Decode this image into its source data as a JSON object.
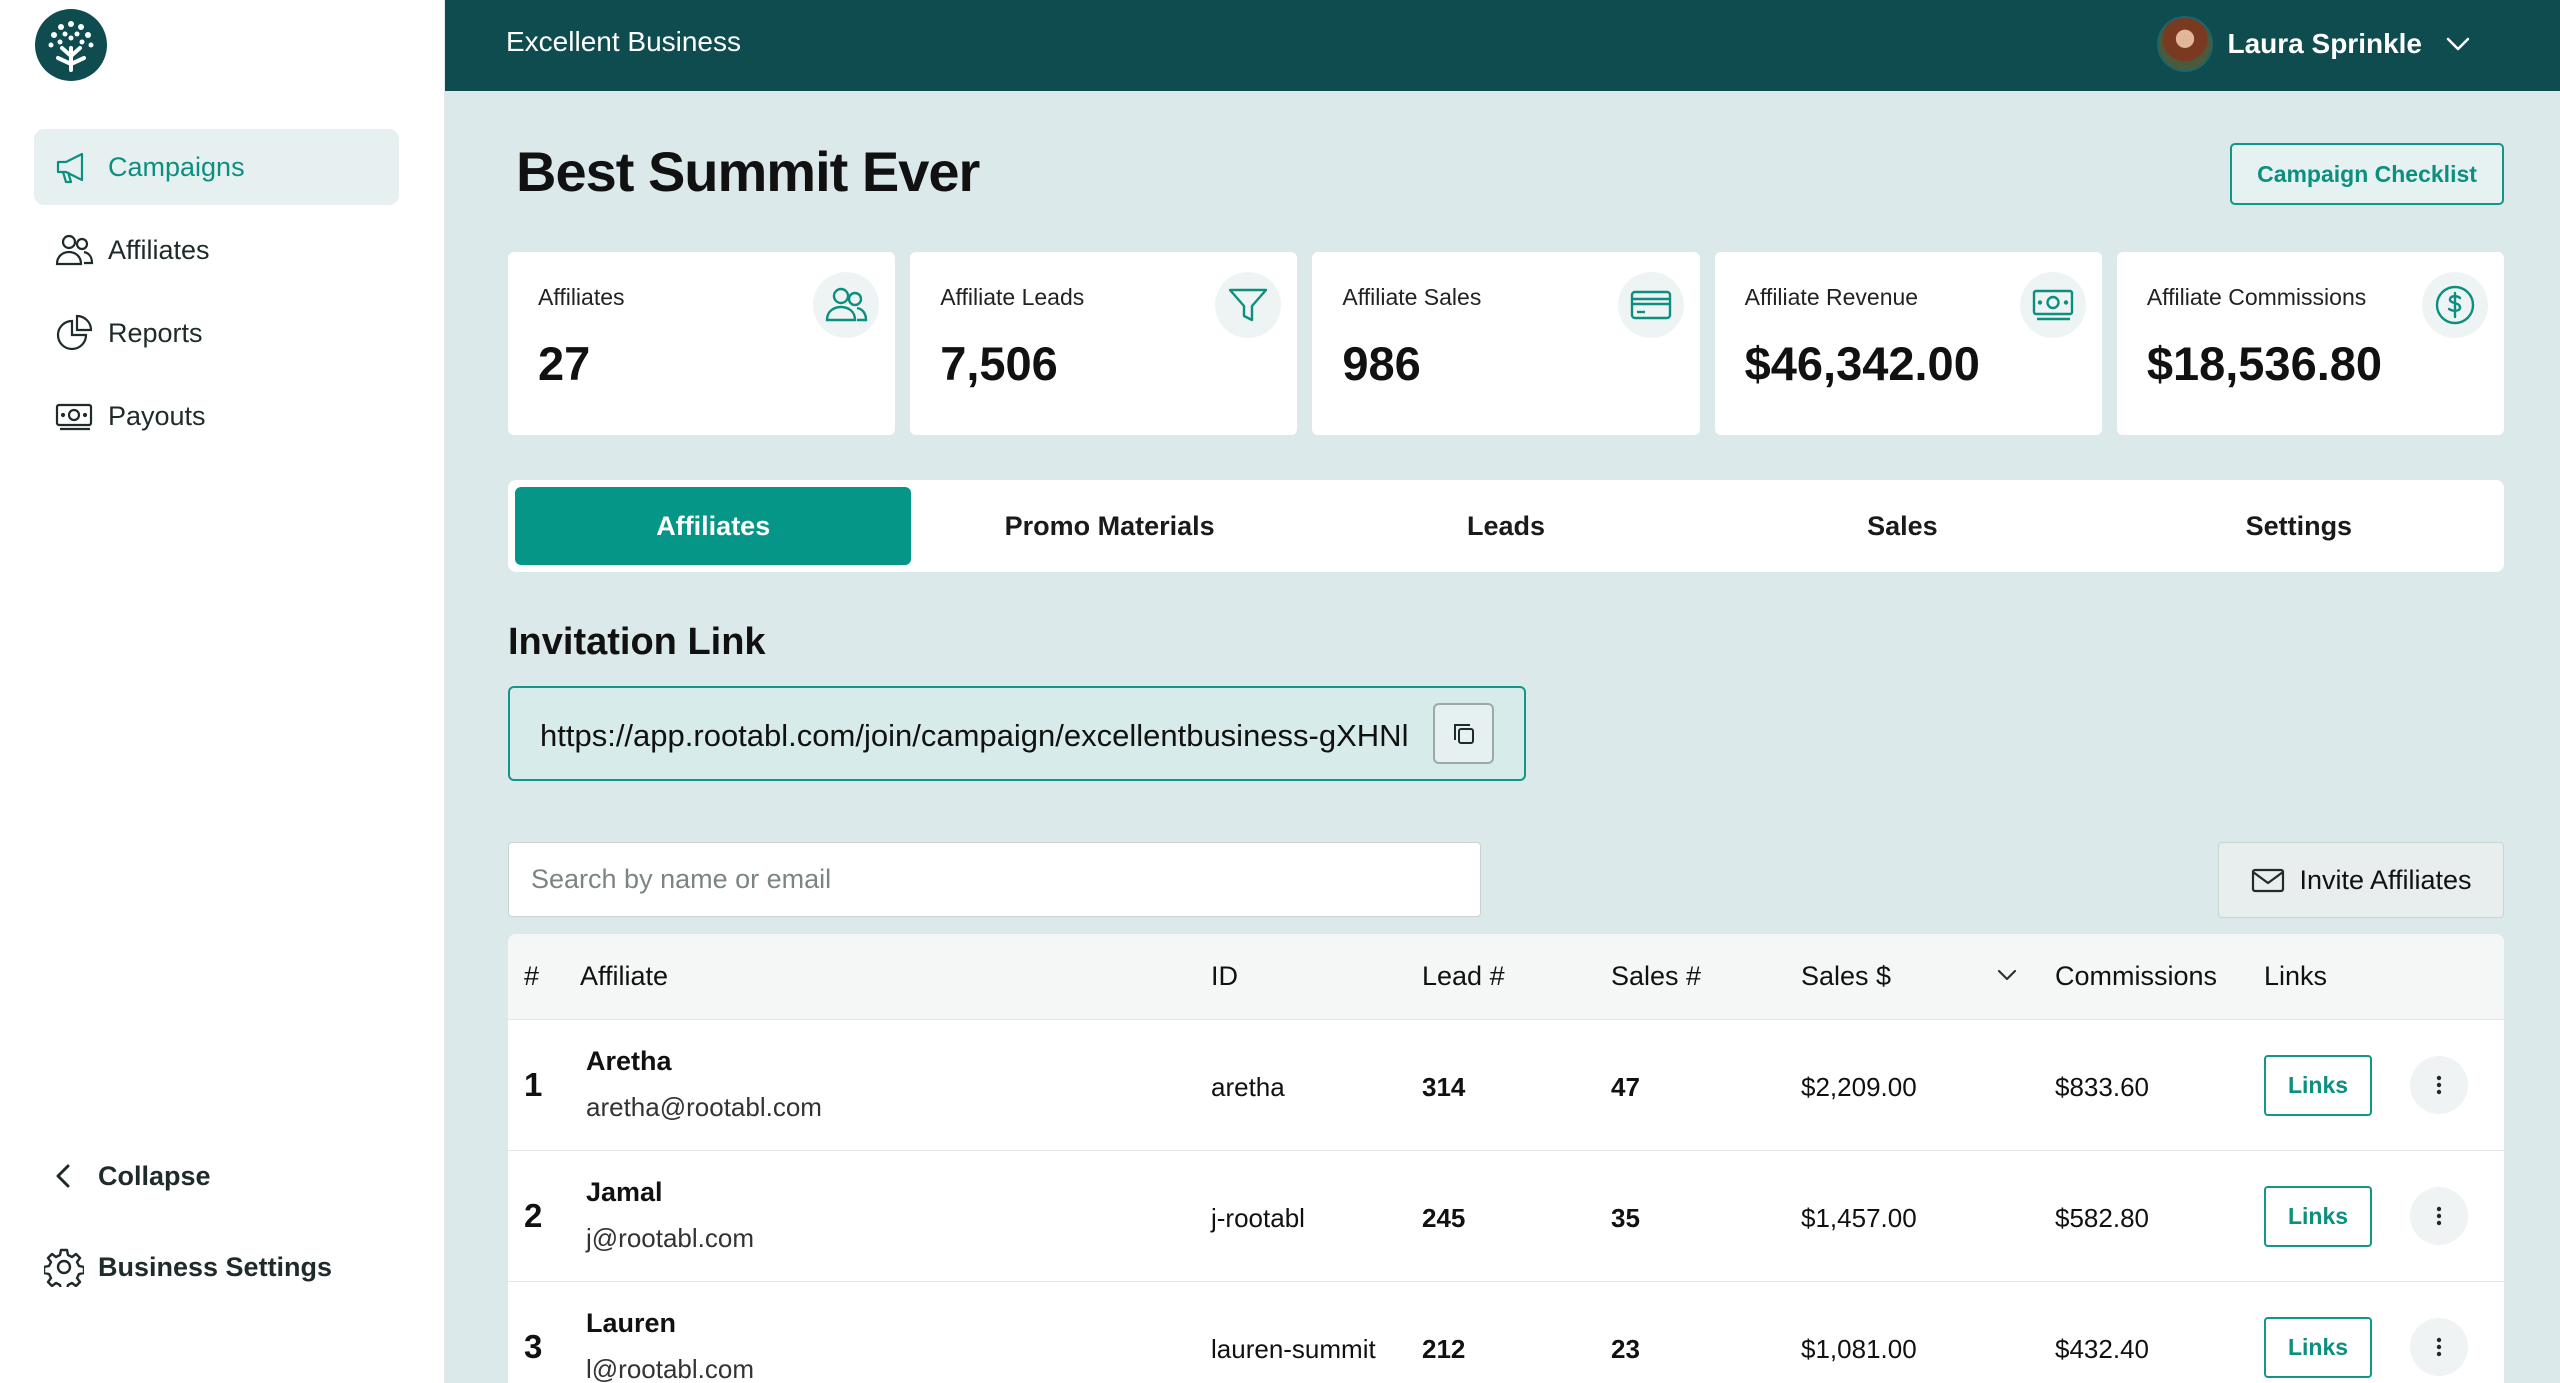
{
  "sidebar": {
    "items": [
      {
        "label": "Campaigns",
        "icon": "megaphone-icon",
        "active": true
      },
      {
        "label": "Affiliates",
        "icon": "users-icon"
      },
      {
        "label": "Reports",
        "icon": "pie-chart-icon"
      },
      {
        "label": "Payouts",
        "icon": "cash-icon"
      }
    ],
    "collapse_label": "Collapse",
    "settings_label": "Business Settings"
  },
  "topbar": {
    "business_name": "Excellent Business",
    "user_name": "Laura Sprinkle"
  },
  "page": {
    "title": "Best Summit Ever",
    "checklist_label": "Campaign Checklist"
  },
  "stats": [
    {
      "label": "Affiliates",
      "value": "27",
      "icon": "users-icon"
    },
    {
      "label": "Affiliate Leads",
      "value": "7,506",
      "icon": "funnel-icon"
    },
    {
      "label": "Affiliate Sales",
      "value": "986",
      "icon": "credit-card-icon"
    },
    {
      "label": "Affiliate Revenue",
      "value": "$46,342.00",
      "icon": "cash-icon"
    },
    {
      "label": "Affiliate Commissions",
      "value": "$18,536.80",
      "icon": "dollar-circle-icon"
    }
  ],
  "tabs": [
    {
      "label": "Affiliates",
      "active": true
    },
    {
      "label": "Promo Materials"
    },
    {
      "label": "Leads"
    },
    {
      "label": "Sales"
    },
    {
      "label": "Settings"
    }
  ],
  "invitation": {
    "title": "Invitation Link",
    "url": "https://app.rootabl.com/join/campaign/excellentbusiness-gXHNl"
  },
  "search": {
    "placeholder": "Search by name or email"
  },
  "invite_label": "Invite Affiliates",
  "table": {
    "headers": {
      "num": "#",
      "affiliate": "Affiliate",
      "id": "ID",
      "lead": "Lead #",
      "sales_count": "Sales #",
      "sales_amount": "Sales $",
      "commissions": "Commissions",
      "links": "Links"
    },
    "rows": [
      {
        "num": "1",
        "name": "Aretha",
        "email": "aretha@rootabl.com",
        "id": "aretha",
        "leads": "314",
        "sales": "47",
        "sales_amount": "$2,209.00",
        "commissions": "$833.60",
        "links": "Links"
      },
      {
        "num": "2",
        "name": "Jamal",
        "email": "j@rootabl.com",
        "id": "j-rootabl",
        "leads": "245",
        "sales": "35",
        "sales_amount": "$1,457.00",
        "commissions": "$582.80",
        "links": "Links"
      },
      {
        "num": "3",
        "name": "Lauren",
        "email": "l@rootabl.com",
        "id": "lauren-summit",
        "leads": "212",
        "sales": "23",
        "sales_amount": "$1,081.00",
        "commissions": "$432.40",
        "links": "Links"
      }
    ]
  },
  "colors": {
    "primary": "#069687",
    "topbar": "#0f4c4f",
    "background": "#dbe9ea"
  }
}
